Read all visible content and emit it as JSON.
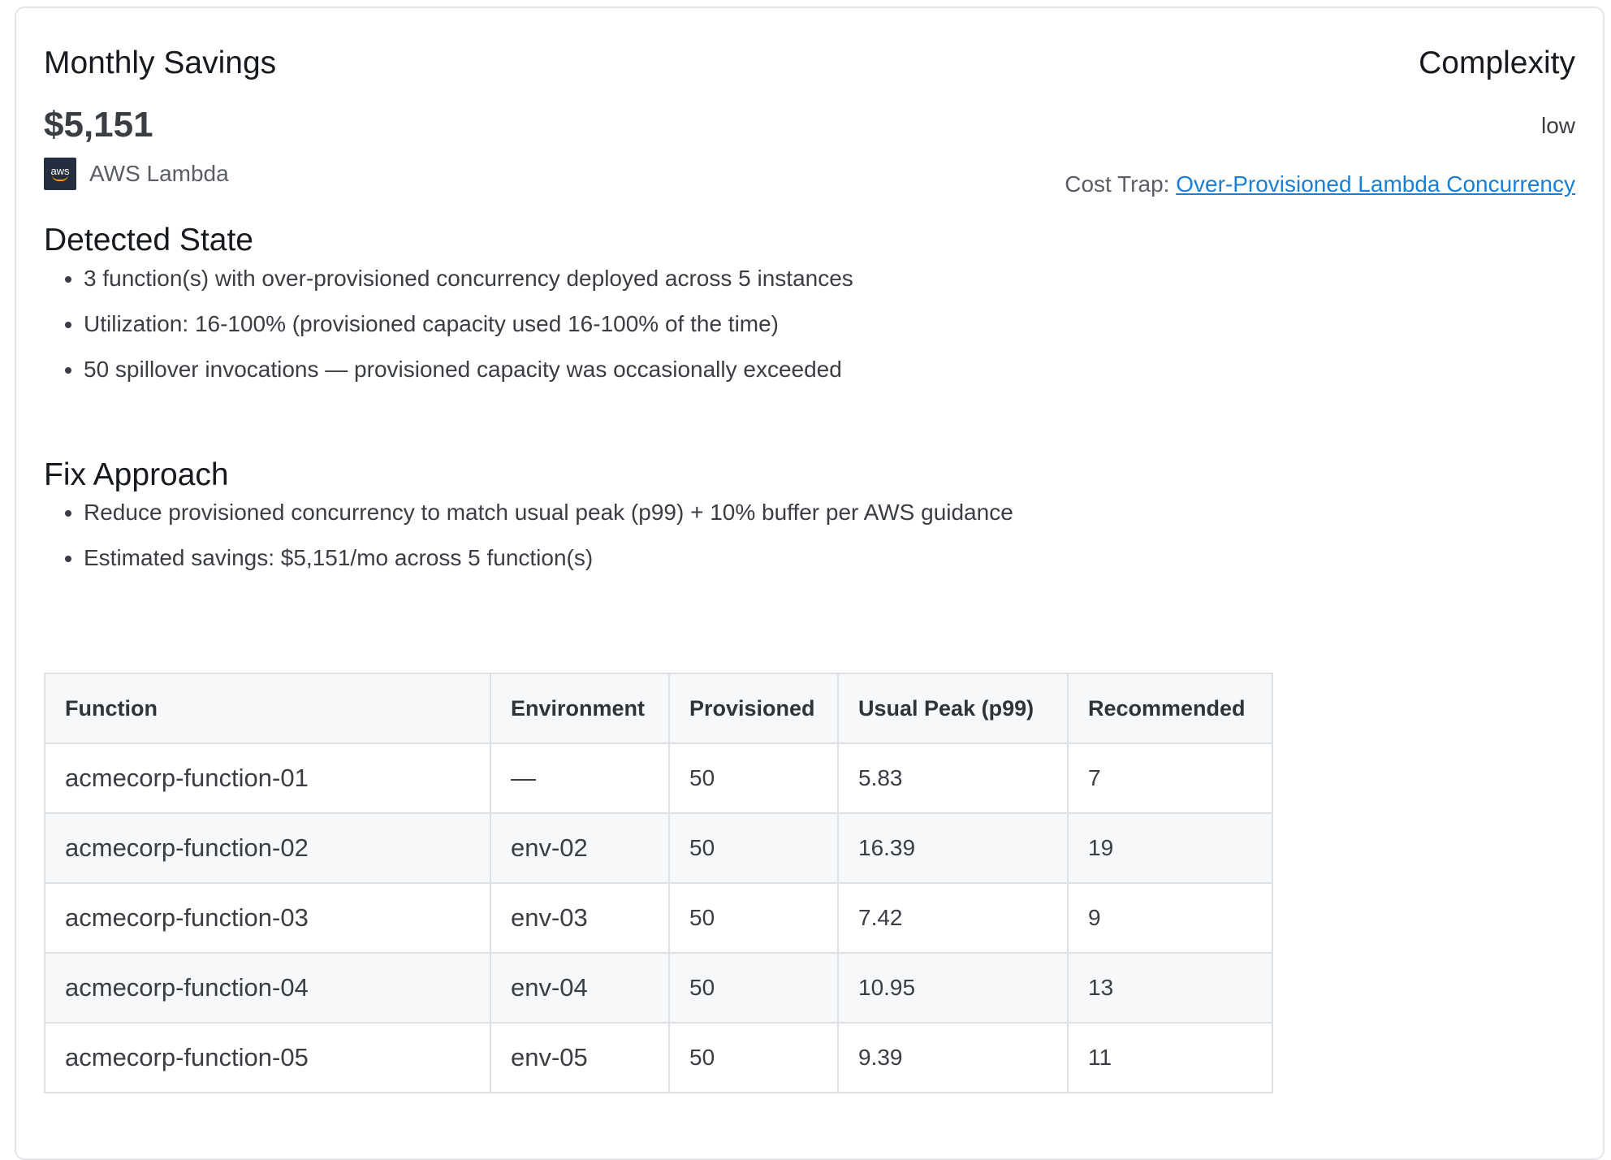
{
  "header": {
    "savings_label": "Monthly Savings",
    "savings_amount": "$5,151",
    "service_icon": "aws-icon",
    "service_icon_text": "aws",
    "service_name": "AWS Lambda",
    "complexity_label": "Complexity",
    "complexity_value": "low",
    "cost_trap_label": "Cost Trap:",
    "cost_trap_link": "Over-Provisioned Lambda Concurrency"
  },
  "detected_state": {
    "title": "Detected State",
    "items": [
      "3 function(s) with over-provisioned concurrency deployed across 5 instances",
      "Utilization: 16-100% (provisioned capacity used 16-100% of the time)",
      "50 spillover invocations — provisioned capacity was occasionally exceeded"
    ]
  },
  "fix_approach": {
    "title": "Fix Approach",
    "items": [
      "Reduce provisioned concurrency to match usual peak (p99) + 10% buffer per AWS guidance",
      "Estimated savings: $5,151/mo across 5 function(s)"
    ]
  },
  "table": {
    "headers": [
      "Function",
      "Environment",
      "Provisioned",
      "Usual Peak (p99)",
      "Recommended"
    ],
    "rows": [
      [
        "acmecorp-function-01",
        "—",
        "50",
        "5.83",
        "7"
      ],
      [
        "acmecorp-function-02",
        "env-02",
        "50",
        "16.39",
        "19"
      ],
      [
        "acmecorp-function-03",
        "env-03",
        "50",
        "7.42",
        "9"
      ],
      [
        "acmecorp-function-04",
        "env-04",
        "50",
        "10.95",
        "13"
      ],
      [
        "acmecorp-function-05",
        "env-05",
        "50",
        "9.39",
        "11"
      ]
    ]
  },
  "colors": {
    "link": "#1a7fd6",
    "aws_icon_bg": "#232f3e",
    "aws_smile": "#ff9900",
    "table_header_bg": "#f6f8fa"
  }
}
